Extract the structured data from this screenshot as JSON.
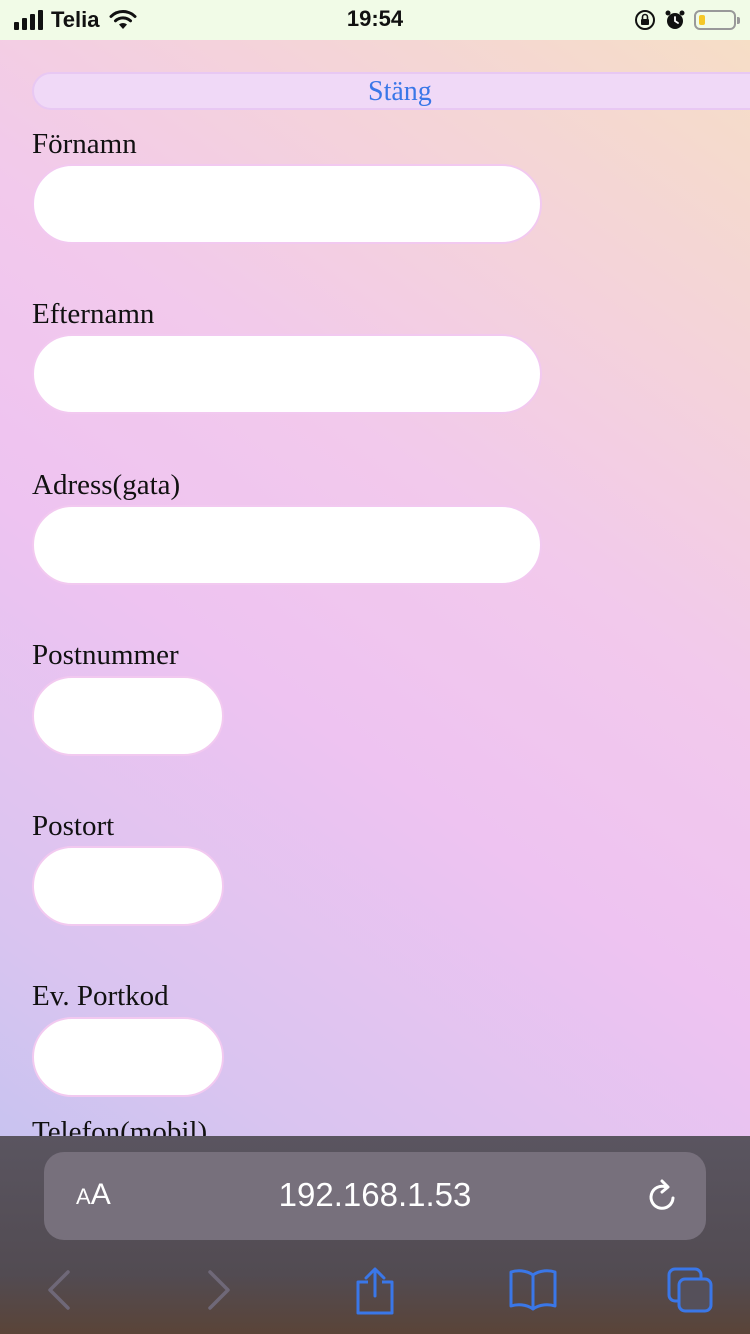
{
  "status_bar": {
    "carrier": "Telia",
    "time": "19:54",
    "battery_level": 0.2,
    "battery_color": "#f5c827"
  },
  "header": {
    "close_label": "Stäng"
  },
  "form": {
    "fields": [
      {
        "label": "Förnamn",
        "value": ""
      },
      {
        "label": "Efternamn",
        "value": ""
      },
      {
        "label": "Adress(gata)",
        "value": ""
      },
      {
        "label": "Postnummer",
        "value": ""
      },
      {
        "label": "Postort",
        "value": ""
      },
      {
        "label": "Ev. Portkod",
        "value": ""
      },
      {
        "label": "Telefon(mobil)"
      }
    ]
  },
  "browser": {
    "text_size_label": "AA",
    "url": "192.168.1.53",
    "toolbar_icons": [
      "back-icon",
      "forward-icon",
      "share-icon",
      "bookmarks-icon",
      "tabs-icon"
    ],
    "accent_color": "#3a77e8"
  }
}
